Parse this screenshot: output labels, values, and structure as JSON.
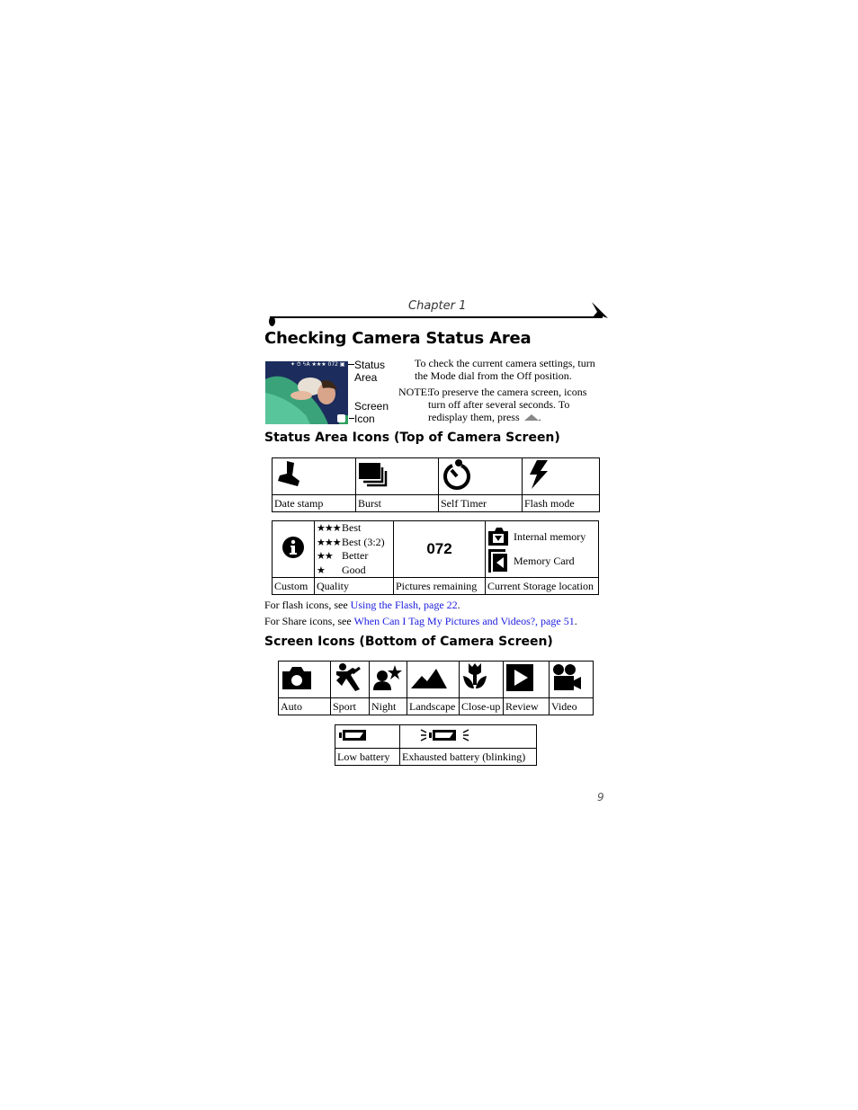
{
  "header": {
    "chapter": "Chapter 1"
  },
  "title": "Checking Camera Status Area",
  "intro": {
    "image_alt": "Camera screen showing child sleeping",
    "overlay_status": "✦ ⏱ ϟA ★★★ 072 ▣",
    "callouts": {
      "status_area": [
        "Status",
        "Area"
      ],
      "screen_icon": [
        "Screen",
        "Icon"
      ]
    },
    "paragraph": [
      "To check the current camera settings, turn",
      "the Mode dial from the Off position."
    ],
    "note_label": "NOTE:",
    "note_lines": [
      "To preserve the camera screen, icons",
      "turn off after several seconds. To",
      "redisplay them, press"
    ],
    "note_suffix": "."
  },
  "status_section": {
    "heading": "Status Area Icons (Top of Camera Screen)",
    "row1": [
      {
        "icon": "date-stamp-icon",
        "label": "Date stamp"
      },
      {
        "icon": "burst-icon",
        "label": "Burst"
      },
      {
        "icon": "self-timer-icon",
        "label": "Self Timer"
      },
      {
        "icon": "flash-icon",
        "label": "Flash mode"
      }
    ],
    "row2": {
      "custom": {
        "icon": "info-icon",
        "label": "Custom"
      },
      "quality": {
        "label": "Quality",
        "items": [
          {
            "stars": "★★★",
            "text": "Best"
          },
          {
            "stars": "★★★",
            "text": "Best (3:2)"
          },
          {
            "stars": "★★",
            "text": "Better"
          },
          {
            "stars": "★",
            "text": "Good"
          }
        ]
      },
      "pictures": {
        "value": "072",
        "label": "Pictures remaining"
      },
      "storage": {
        "label": "Current Storage location",
        "items": [
          {
            "icon": "internal-memory-icon",
            "text": "Internal memory"
          },
          {
            "icon": "memory-card-icon",
            "text": "Memory Card"
          }
        ]
      }
    },
    "refs": [
      {
        "prefix": "For flash icons, see ",
        "link": "Using the Flash, page 22",
        "suffix": "."
      },
      {
        "prefix": "For Share icons, see ",
        "link": "When Can I Tag My Pictures and Videos?, page 51",
        "suffix": "."
      }
    ]
  },
  "screen_section": {
    "heading": "Screen Icons (Bottom of Camera Screen)",
    "modes": [
      {
        "icon": "camera-icon",
        "label": "Auto"
      },
      {
        "icon": "sport-icon",
        "label": "Sport"
      },
      {
        "icon": "night-icon",
        "label": "Night"
      },
      {
        "icon": "landscape-icon",
        "label": "Landscape"
      },
      {
        "icon": "close-up-icon",
        "label": "Close-up"
      },
      {
        "icon": "review-icon",
        "label": "Review"
      },
      {
        "icon": "video-icon",
        "label": "Video"
      }
    ],
    "battery": [
      {
        "icon": "low-battery-icon",
        "label": "Low battery"
      },
      {
        "icon": "exhausted-battery-icon",
        "label": "Exhausted battery (blinking)"
      }
    ]
  },
  "colors": {
    "link": "#1a1adf",
    "text": "#000000"
  },
  "page_number": "9"
}
